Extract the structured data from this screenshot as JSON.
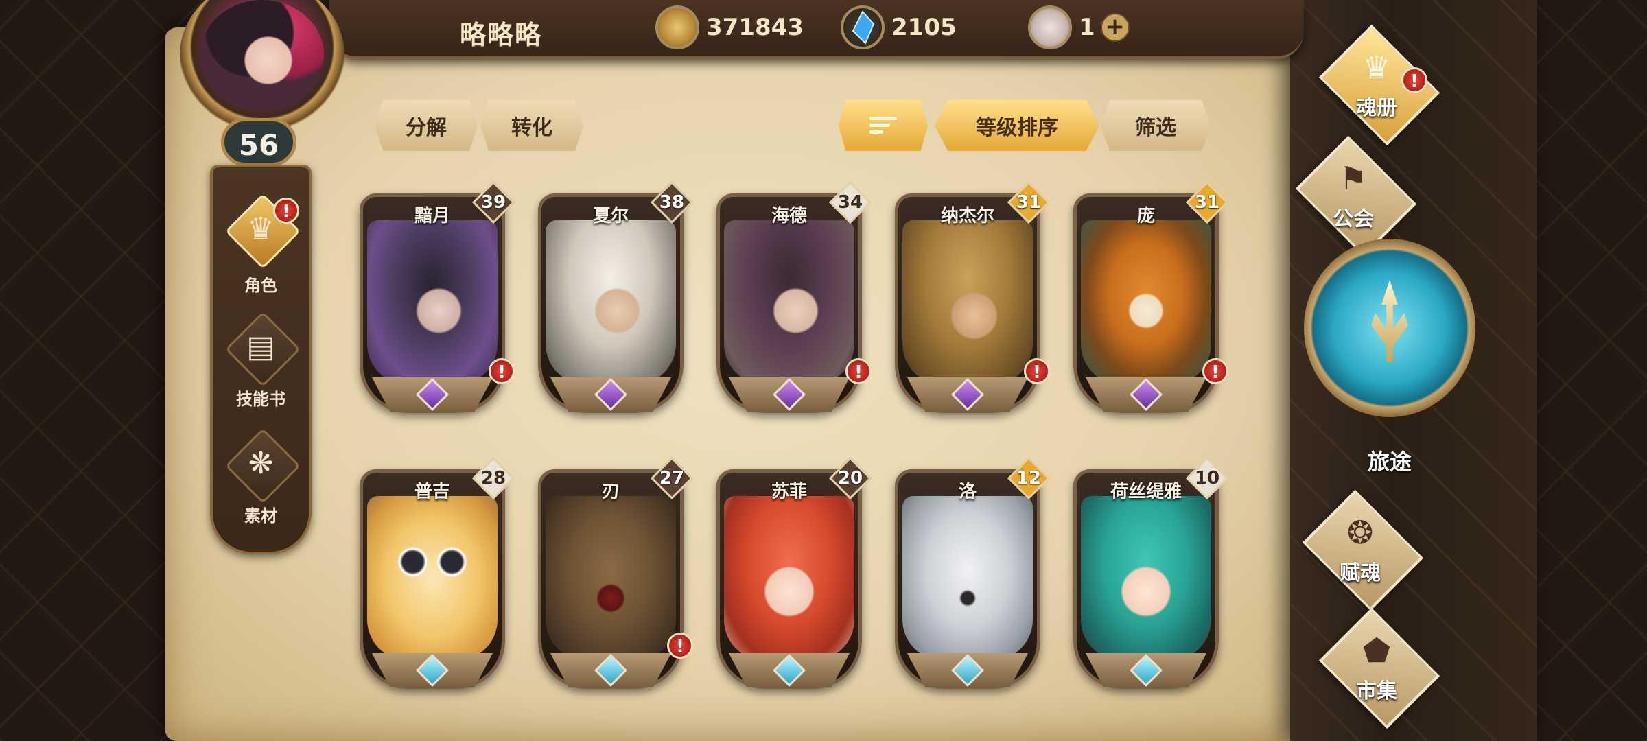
{
  "player": {
    "name": "略略略",
    "level": "56"
  },
  "currencies": [
    {
      "icon": "gold-coin-icon",
      "value": "371843"
    },
    {
      "icon": "blue-crystal-icon",
      "value": "2105"
    },
    {
      "icon": "pink-crystal-icon",
      "value": "1",
      "plus": "+"
    }
  ],
  "side_nav": [
    {
      "label": "角色",
      "icon": "character-icon",
      "active": true,
      "alert": "!"
    },
    {
      "label": "技能书",
      "icon": "skill-book-icon",
      "active": false
    },
    {
      "label": "素材",
      "icon": "material-icon",
      "active": false
    }
  ],
  "toolbar": {
    "decompose": "分解",
    "convert": "转化",
    "sort_toggle": "sort-lines-icon",
    "sort_by_level": "等级排序",
    "filter": "筛选"
  },
  "heroes": [
    {
      "name": "黯月",
      "level": "39",
      "alert": "!",
      "rarity": "purple"
    },
    {
      "name": "夏尔",
      "level": "38",
      "rarity": "purple"
    },
    {
      "name": "海德",
      "level": "34",
      "alert": "!",
      "rarity": "purple"
    },
    {
      "name": "纳杰尔",
      "level": "31",
      "alert": "!",
      "rarity": "purple"
    },
    {
      "name": "庞",
      "level": "31",
      "alert": "!",
      "rarity": "purple"
    },
    {
      "name": "普吉",
      "level": "28",
      "rarity": "blue"
    },
    {
      "name": "刃",
      "level": "27",
      "alert": "!",
      "rarity": "blue"
    },
    {
      "name": "苏菲",
      "level": "20",
      "rarity": "blue"
    },
    {
      "name": "洛",
      "level": "12",
      "rarity": "blue"
    },
    {
      "name": "荷丝缇雅",
      "level": "10",
      "rarity": "blue"
    }
  ],
  "right_nav": {
    "soul_book": "魂册",
    "guild": "公会",
    "journey": "旅途",
    "soul_imbue": "赋魂",
    "market": "市集",
    "alert": "!"
  },
  "colors": {
    "level_badge_dark": "#5a4030",
    "level_badge_white": "#e9e2d6",
    "level_badge_gold": "#e8a92c",
    "alert_red": "#c7291f"
  }
}
